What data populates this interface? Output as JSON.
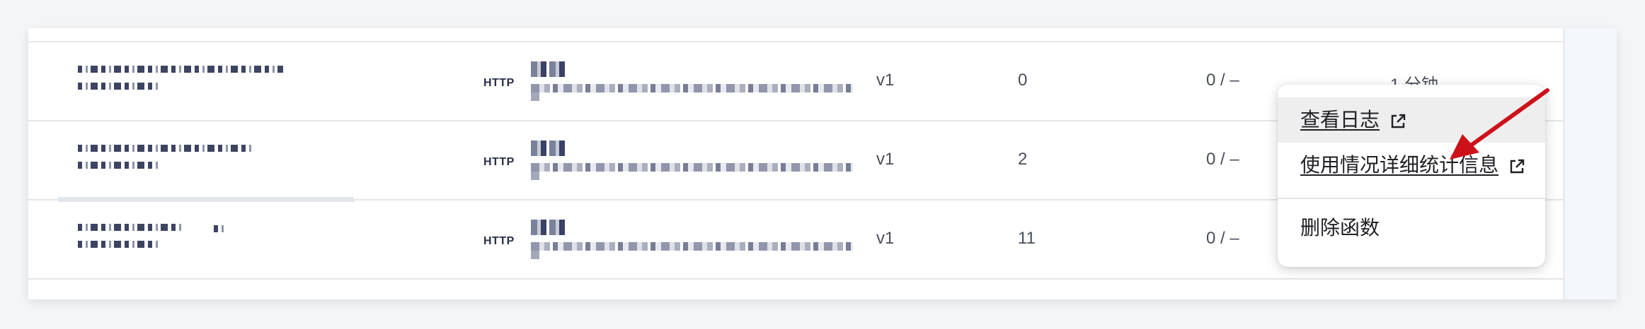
{
  "rows": [
    {
      "trigger": "HTTP",
      "version": "v1",
      "count": "0",
      "errors": "0 / –",
      "time": "1 分钟"
    },
    {
      "trigger": "HTTP",
      "version": "v1",
      "count": "2",
      "errors": "0 / –",
      "time": ""
    },
    {
      "trigger": "HTTP",
      "version": "v1",
      "count": "11",
      "errors": "0 / –",
      "time": ""
    }
  ],
  "menu": {
    "view_logs": "查看日志",
    "usage_details": "使用情况详细统计信息",
    "delete_function": "删除函数"
  },
  "icons": {
    "external_link": "external-link-icon"
  },
  "colors": {
    "annotation_arrow": "#cc1118"
  }
}
